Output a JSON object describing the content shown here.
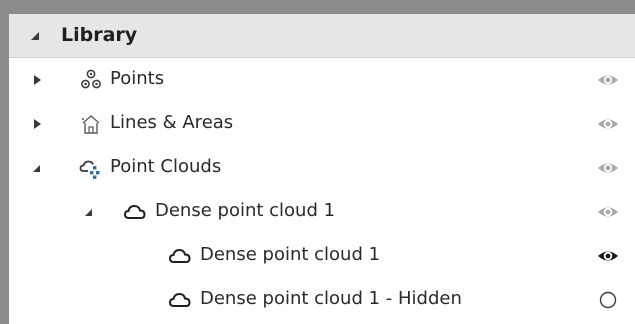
{
  "library": {
    "title": "Library",
    "items": [
      {
        "label": "Points",
        "icon": "points-icon",
        "expanded": false,
        "visibility": "visible-dim"
      },
      {
        "label": "Lines & Areas",
        "icon": "lines-areas-icon",
        "expanded": false,
        "visibility": "visible-dim"
      },
      {
        "label": "Point Clouds",
        "icon": "point-clouds-icon",
        "expanded": true,
        "visibility": "visible-dim"
      },
      {
        "label": "Dense point cloud 1",
        "icon": "cloud-icon",
        "expanded": true,
        "visibility": "visible-dim"
      },
      {
        "label": "Dense point cloud 1",
        "icon": "cloud-icon",
        "visibility": "visible"
      },
      {
        "label": "Dense point cloud 1 - Hidden",
        "icon": "cloud-icon",
        "visibility": "hidden"
      }
    ]
  },
  "colors": {
    "frame": "#8c8c8c",
    "header_bg": "#e6e6e6",
    "text": "#2a2a2a",
    "eye_dim": "#a8a8a8",
    "eye_active": "#1e1e1e"
  }
}
